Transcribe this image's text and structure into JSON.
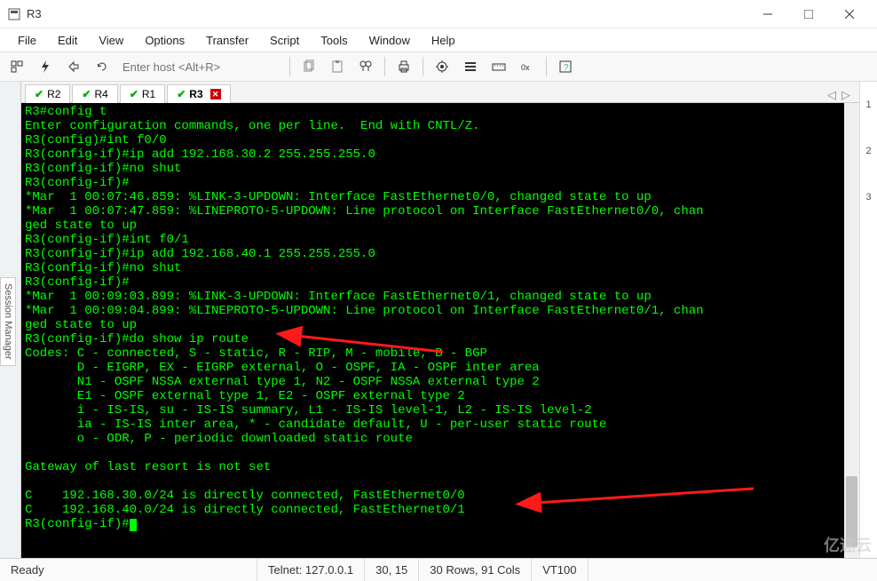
{
  "window": {
    "title": "R3"
  },
  "menu": {
    "items": [
      "File",
      "Edit",
      "View",
      "Options",
      "Transfer",
      "Script",
      "Tools",
      "Window",
      "Help"
    ]
  },
  "toolbar": {
    "host_placeholder": "Enter host <Alt+R>"
  },
  "sidebar": {
    "tab_label": "Session Manager"
  },
  "tabs": {
    "items": [
      {
        "label": "R2",
        "active": false
      },
      {
        "label": "R4",
        "active": false
      },
      {
        "label": "R1",
        "active": false
      },
      {
        "label": "R3",
        "active": true
      }
    ]
  },
  "terminal": {
    "lines": [
      "R3#config t",
      "Enter configuration commands, one per line.  End with CNTL/Z.",
      "R3(config)#int f0/0",
      "R3(config-if)#ip add 192.168.30.2 255.255.255.0",
      "R3(config-if)#no shut",
      "R3(config-if)#",
      "*Mar  1 00:07:46.859: %LINK-3-UPDOWN: Interface FastEthernet0/0, changed state to up",
      "*Mar  1 00:07:47.859: %LINEPROTO-5-UPDOWN: Line protocol on Interface FastEthernet0/0, chan",
      "ged state to up",
      "R3(config-if)#int f0/1",
      "R3(config-if)#ip add 192.168.40.1 255.255.255.0",
      "R3(config-if)#no shut",
      "R3(config-if)#",
      "*Mar  1 00:09:03.899: %LINK-3-UPDOWN: Interface FastEthernet0/1, changed state to up",
      "*Mar  1 00:09:04.899: %LINEPROTO-5-UPDOWN: Line protocol on Interface FastEthernet0/1, chan",
      "ged state to up",
      "R3(config-if)#do show ip route",
      "Codes: C - connected, S - static, R - RIP, M - mobile, B - BGP",
      "       D - EIGRP, EX - EIGRP external, O - OSPF, IA - OSPF inter area",
      "       N1 - OSPF NSSA external type 1, N2 - OSPF NSSA external type 2",
      "       E1 - OSPF external type 1, E2 - OSPF external type 2",
      "       i - IS-IS, su - IS-IS summary, L1 - IS-IS level-1, L2 - IS-IS level-2",
      "       ia - IS-IS inter area, * - candidate default, U - per-user static route",
      "       o - ODR, P - periodic downloaded static route",
      "",
      "Gateway of last resort is not set",
      "",
      "C    192.168.30.0/24 is directly connected, FastEthernet0/0",
      "C    192.168.40.0/24 is directly connected, FastEthernet0/1",
      "R3(config-if)#"
    ]
  },
  "status": {
    "ready": "Ready",
    "conn": "Telnet: 127.0.0.1",
    "pos": "30,  15",
    "size": "30 Rows, 91 Cols",
    "emu": "VT100"
  },
  "rightstrip": {
    "markers": [
      "1",
      "2",
      "3"
    ]
  },
  "watermark": "亿速云"
}
